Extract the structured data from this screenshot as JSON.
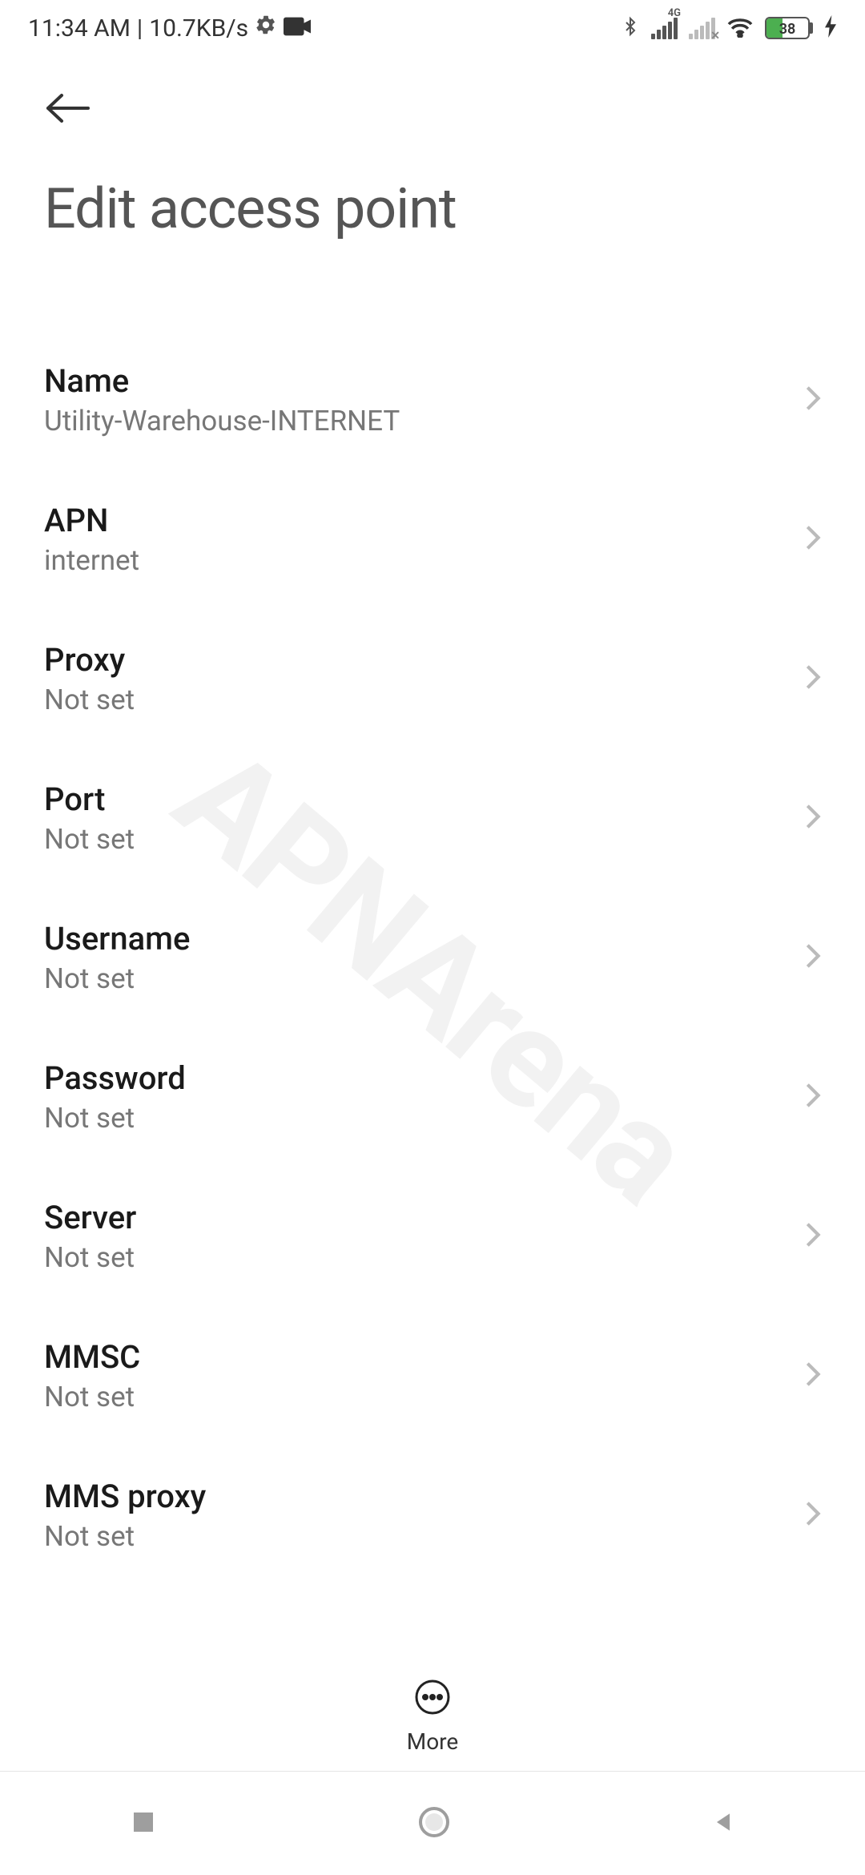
{
  "status": {
    "time": "11:34 AM",
    "speed": "10.7KB/s",
    "battery_pct": "38"
  },
  "header": {
    "title": "Edit access point"
  },
  "rows": [
    {
      "title": "Name",
      "value": "Utility-Warehouse-INTERNET"
    },
    {
      "title": "APN",
      "value": "internet"
    },
    {
      "title": "Proxy",
      "value": "Not set"
    },
    {
      "title": "Port",
      "value": "Not set"
    },
    {
      "title": "Username",
      "value": "Not set"
    },
    {
      "title": "Password",
      "value": "Not set"
    },
    {
      "title": "Server",
      "value": "Not set"
    },
    {
      "title": "MMSC",
      "value": "Not set"
    },
    {
      "title": "MMS proxy",
      "value": "Not set"
    }
  ],
  "more": {
    "label": "More"
  },
  "watermark": "APNArena"
}
